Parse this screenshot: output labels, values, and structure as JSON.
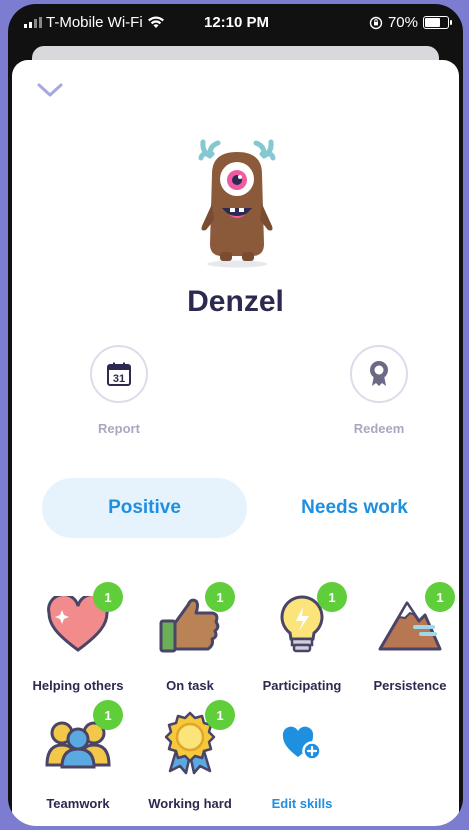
{
  "status_bar": {
    "carrier": "T-Mobile Wi-Fi",
    "time": "12:10 PM",
    "battery": "70%"
  },
  "student": {
    "name": "Denzel"
  },
  "actions": [
    {
      "label": "Report",
      "icon": "calendar-icon",
      "calendar_day": "31"
    },
    {
      "label": "Redeem",
      "icon": "award-ribbon-icon"
    }
  ],
  "tabs": [
    {
      "label": "Positive",
      "active": true
    },
    {
      "label": "Needs work",
      "active": false
    }
  ],
  "skills": [
    {
      "label": "Helping others",
      "count": "1",
      "icon": "heart-icon"
    },
    {
      "label": "On task",
      "count": "1",
      "icon": "thumbs-up-icon"
    },
    {
      "label": "Participating",
      "count": "1",
      "icon": "lightbulb-icon"
    },
    {
      "label": "Persistence",
      "count": "1",
      "icon": "mountain-icon"
    },
    {
      "label": "Teamwork",
      "count": "1",
      "icon": "teamwork-icon"
    },
    {
      "label": "Working hard",
      "count": "1",
      "icon": "medal-icon"
    },
    {
      "label": "Edit skills",
      "icon": "heart-add-icon"
    }
  ],
  "colors": {
    "accent": "#1f8fe0",
    "badge": "#5fce3a",
    "background": "#7c7dd1",
    "title": "#2c2a50"
  }
}
